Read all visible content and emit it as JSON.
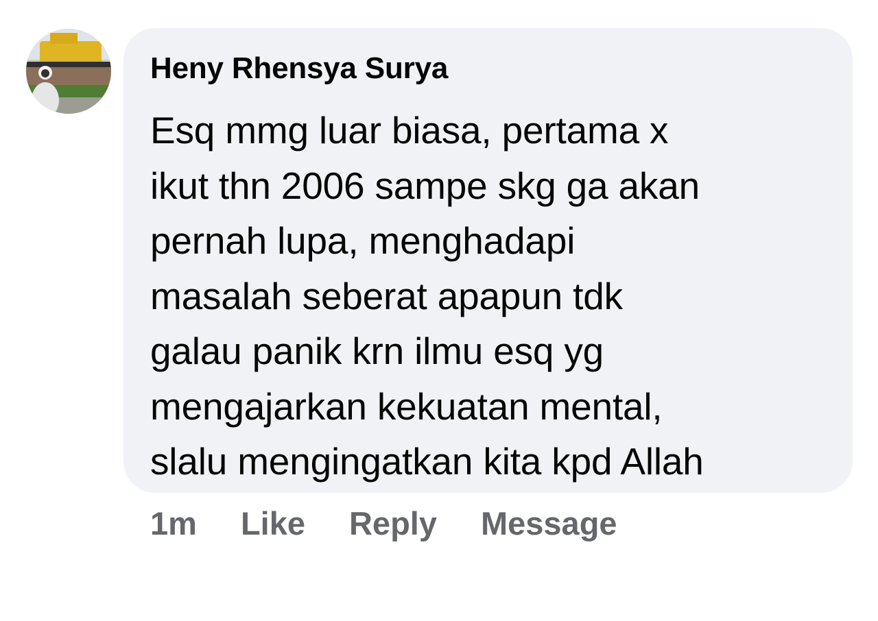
{
  "comment": {
    "author": "Heny Rhensya Surya",
    "avatar_icon": "profile-photo",
    "text_lines": [
      "Esq mmg luar biasa, pertama x",
      "ikut thn 2006 sampe skg ga akan",
      "pernah lupa, menghadapi",
      "masalah seberat apapun tdk",
      "galau panik krn ilmu esq yg",
      "mengajarkan kekuatan mental,",
      "slalu mengingatkan kita kpd Allah"
    ],
    "time": "1m",
    "actions": {
      "like": "Like",
      "reply": "Reply",
      "message": "Message"
    }
  },
  "colors": {
    "bubble_bg": "#f0f2f5",
    "text": "#050505",
    "secondary": "#65676b"
  }
}
